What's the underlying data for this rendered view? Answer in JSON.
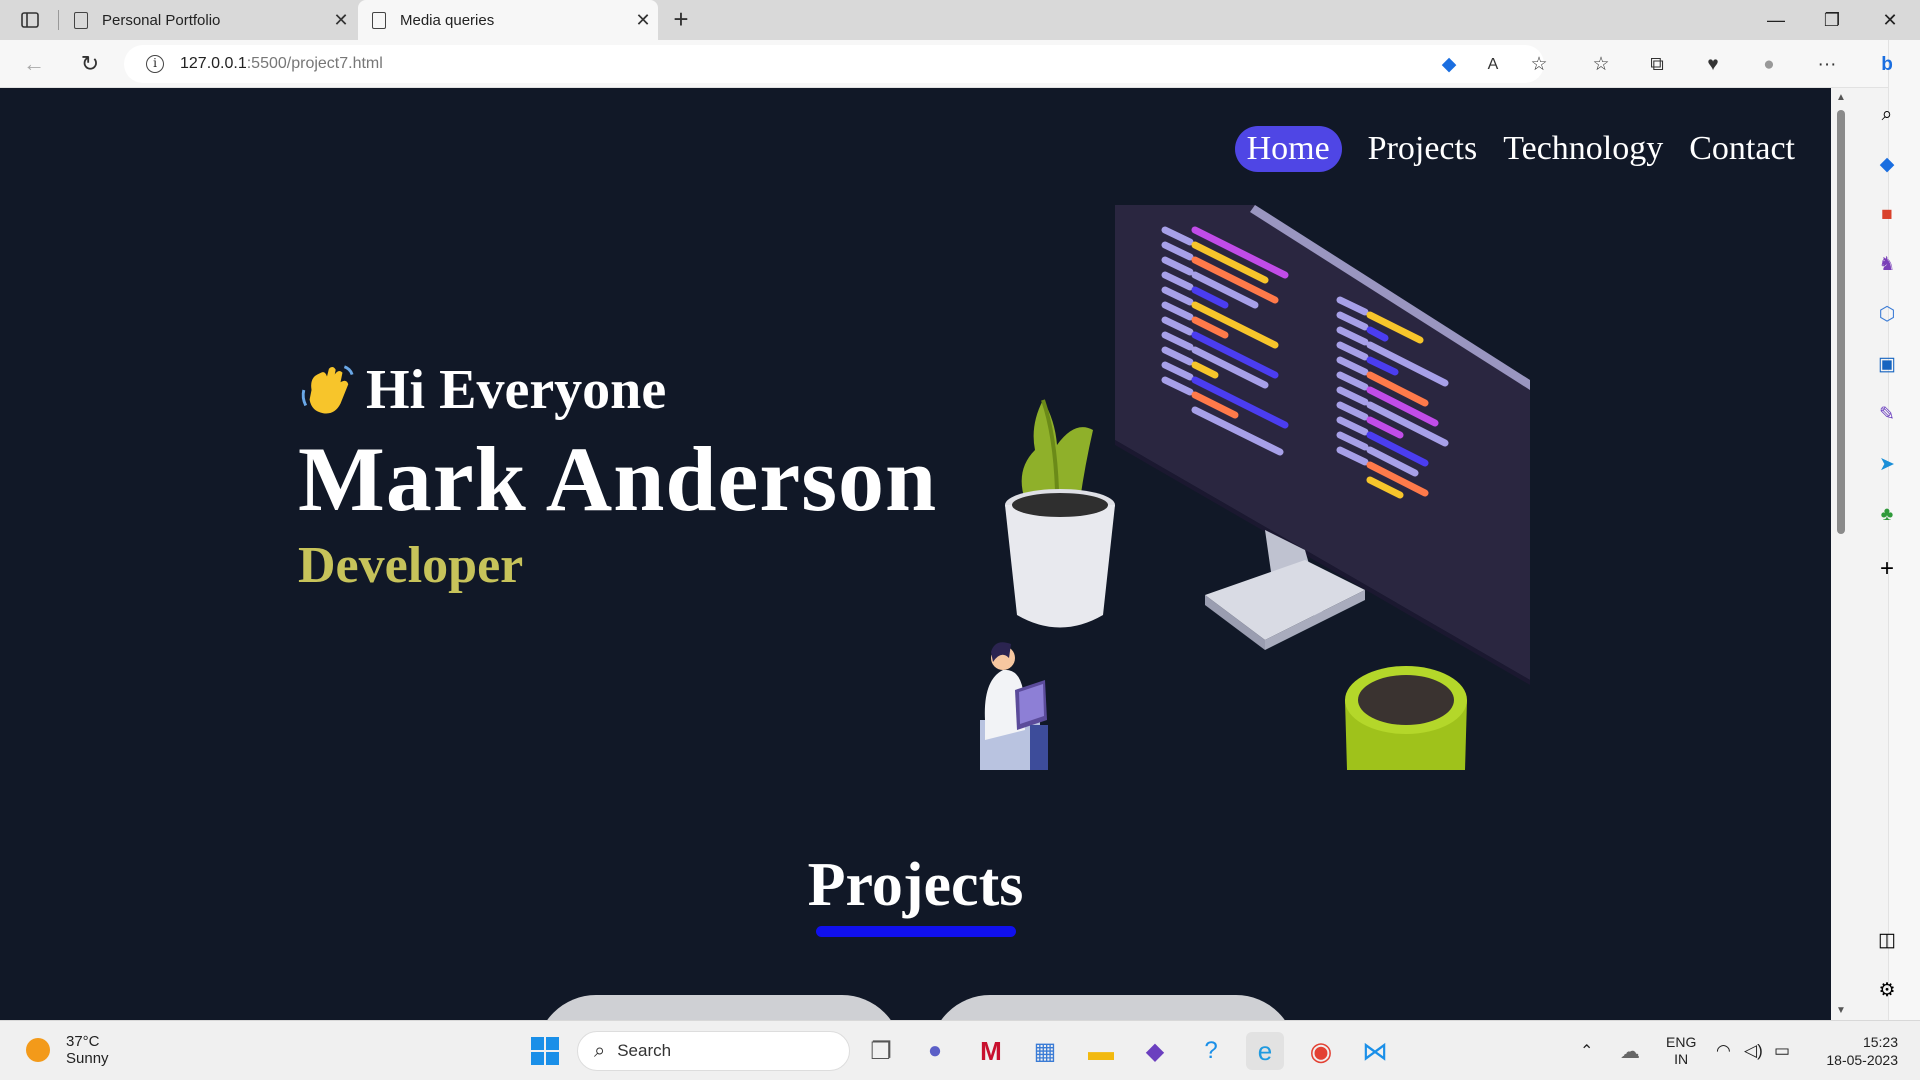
{
  "browser": {
    "tabs": [
      {
        "title": "Personal Portfolio",
        "active": false
      },
      {
        "title": "Media queries",
        "active": true
      }
    ],
    "url_host": "127.0.0.1",
    "url_path": ":5500/project7.html"
  },
  "page": {
    "nav": [
      "Home",
      "Projects",
      "Technology",
      "Contact"
    ],
    "greeting": "Hi Everyone",
    "name": "Mark Anderson",
    "role": "Developer",
    "projects_heading": "Projects",
    "colors": {
      "background": "#111827",
      "active_nav": "#4f46e5",
      "role": "#c7c35a",
      "underline": "#1010ee"
    }
  },
  "taskbar": {
    "temperature": "37°C",
    "condition": "Sunny",
    "search_placeholder": "Search",
    "language": "ENG",
    "region": "IN",
    "time": "15:23",
    "date": "18-05-2023"
  }
}
